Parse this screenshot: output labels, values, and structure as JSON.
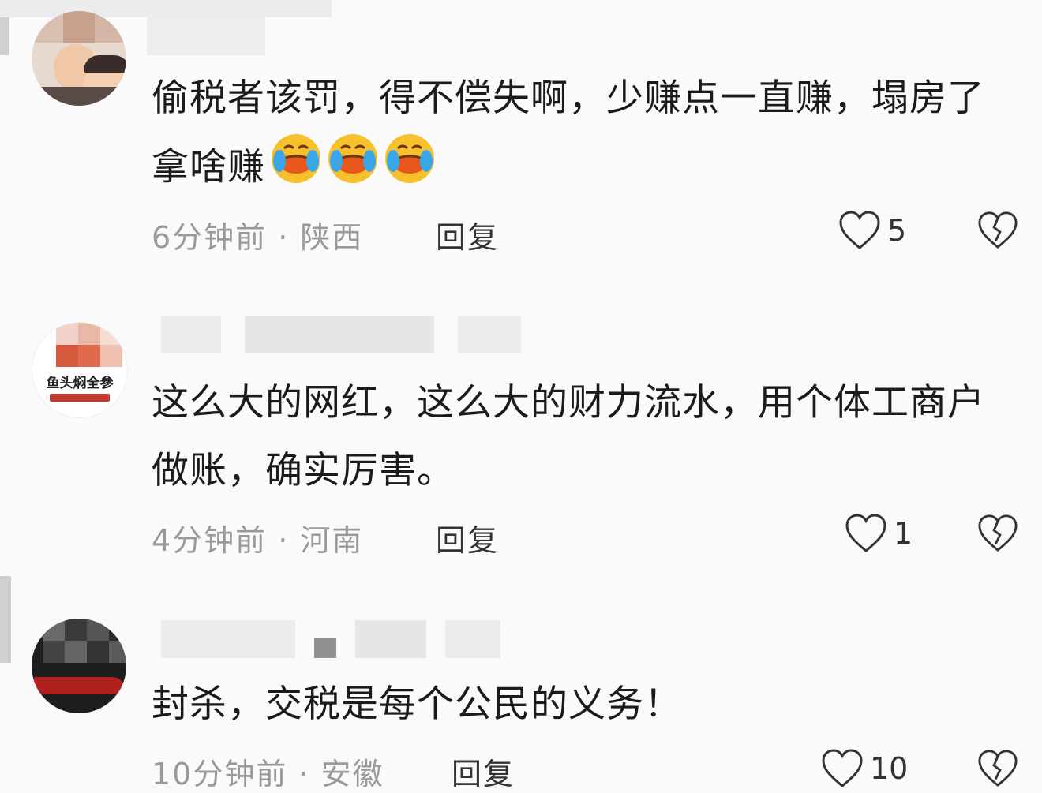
{
  "comments": [
    {
      "text": "偷税者该罚，得不偿失啊，少赚点一直赚，塌房了拿啥赚",
      "emoji": [
        "face-with-tears-of-joy-emoji",
        "face-with-tears-of-joy-emoji",
        "face-with-tears-of-joy-emoji"
      ],
      "meta": "6分钟前 · 陕西",
      "reply": "回复",
      "likes": "5",
      "like_icon": "heart-outline-icon",
      "dislike_icon": "broken-heart-icon"
    },
    {
      "text": "这么大的网红，这么大的财力流水，用个体工商户做账，确实厉害。",
      "meta": "4分钟前 · 河南",
      "reply": "回复",
      "likes": "1",
      "avatar_text": "鱼头焖全参",
      "like_icon": "heart-outline-icon",
      "dislike_icon": "broken-heart-icon"
    },
    {
      "text": "封杀，交税是每个公民的义务！",
      "meta": "10分钟前 · 安徽",
      "reply": "回复",
      "likes": "10",
      "like_icon": "heart-outline-icon",
      "dislike_icon": "broken-heart-icon"
    }
  ],
  "colors": {
    "background": "#fafafa",
    "meta": "#9a9a9a",
    "text": "#1b1b1b"
  }
}
